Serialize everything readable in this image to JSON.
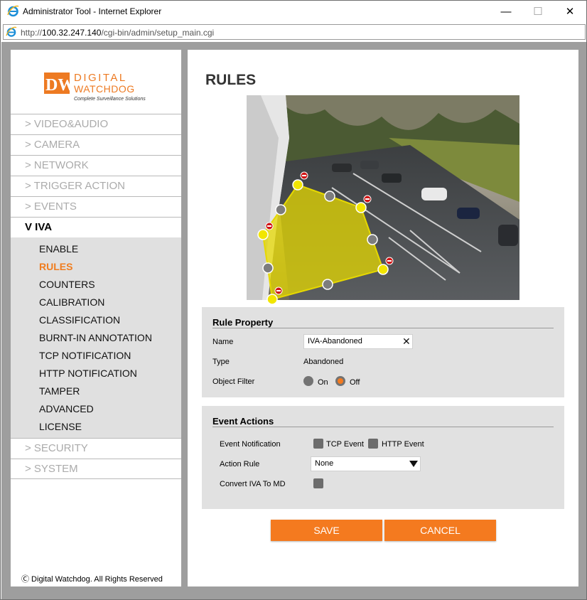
{
  "window": {
    "title": "Administrator Tool - Internet Explorer",
    "url_prefix": "http://",
    "url_host": "100.32.247.140",
    "url_path": "/cgi-bin/admin/setup_main.cgi",
    "minimize": "—",
    "maximize": "☐",
    "close": "✕"
  },
  "logo": {
    "mark": "DW",
    "line1": "DIGITAL",
    "line2": "WATCHDOG",
    "tagline": "Complete Surveillance Solutions"
  },
  "sidebar": {
    "menu": [
      {
        "label": "> VIDEO&AUDIO"
      },
      {
        "label": "> CAMERA"
      },
      {
        "label": "> NETWORK"
      },
      {
        "label": "> TRIGGER ACTION"
      },
      {
        "label": "> EVENTS"
      },
      {
        "label": "V IVA"
      }
    ],
    "iva_items": [
      {
        "label": "ENABLE"
      },
      {
        "label": "RULES"
      },
      {
        "label": "COUNTERS"
      },
      {
        "label": "CALIBRATION"
      },
      {
        "label": "CLASSIFICATION"
      },
      {
        "label": "BURNT-IN ANNOTATION"
      },
      {
        "label": "TCP NOTIFICATION"
      },
      {
        "label": "HTTP NOTIFICATION"
      },
      {
        "label": "TAMPER"
      },
      {
        "label": "ADVANCED"
      },
      {
        "label": "LICENSE"
      }
    ],
    "menu_after": [
      {
        "label": "> SECURITY"
      },
      {
        "label": "> SYSTEM"
      }
    ],
    "copyright": "Ⓒ Digital Watchdog. All Rights Reserved"
  },
  "main": {
    "title": "RULES",
    "rule_property": {
      "heading": "Rule Property",
      "name_label": "Name",
      "name_value": "IVA-Abandoned",
      "type_label": "Type",
      "type_value": "Abandoned",
      "object_filter_label": "Object Filter",
      "on_label": "On",
      "off_label": "Off",
      "selected": "Off"
    },
    "event_actions": {
      "heading": "Event Actions",
      "event_notification_label": "Event Notification",
      "tcp_event_label": "TCP Event",
      "http_event_label": "HTTP Event",
      "action_rule_label": "Action Rule",
      "action_rule_value": "None",
      "convert_label": "Convert IVA To MD"
    },
    "save_label": "SAVE",
    "cancel_label": "CANCEL"
  },
  "colors": {
    "accent": "#f47a1f",
    "zone_fill": "#e6d800",
    "panel_bg": "#e1e1e1",
    "frame_bg": "#9e9e9e"
  }
}
